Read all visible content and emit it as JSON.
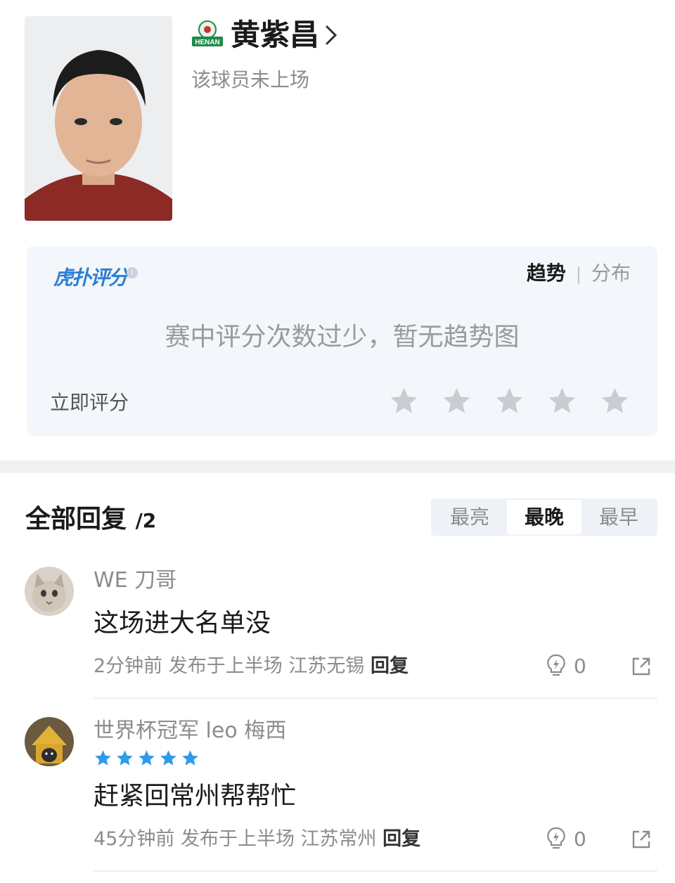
{
  "player": {
    "name": "黄紫昌",
    "status": "该球员未上场",
    "team_badge_text": "HENAN"
  },
  "rating": {
    "logo_text": "虎扑评分",
    "logo_mark": "®",
    "info_icon": "i",
    "tabs": {
      "active": "趋势",
      "separator": "|",
      "other": "分布"
    },
    "empty_message": "赛中评分次数过少，暂无趋势图",
    "rate_now_label": "立即评分",
    "star_count": 5
  },
  "replies": {
    "title": "全部回复",
    "count": "/2",
    "sort_tabs": [
      "最亮",
      "最晚",
      "最早"
    ],
    "active_sort": "最晚"
  },
  "comments": [
    {
      "username": "WE 刀哥",
      "text": "这场进大名单没",
      "time": "2分钟前",
      "published": "发布于上半场",
      "location": "江苏无锡",
      "reply_label": "回复",
      "likes": "0",
      "stars": 0
    },
    {
      "username": "世界杯冠军 leo 梅西",
      "text": "赶紧回常州帮帮忙",
      "time": "45分钟前",
      "published": "发布于上半场",
      "location": "江苏常州",
      "reply_label": "回复",
      "likes": "0",
      "stars": 5
    }
  ],
  "colors": {
    "accent_blue": "#2b7fd0",
    "star_blue": "#2f9be8",
    "star_grey": "#c9ccd1",
    "jersey_red": "#8c2a25",
    "badge_green": "#1f8a4c"
  },
  "icons": [
    "team-badge-icon",
    "chevron-right-icon",
    "info-icon",
    "star-icon",
    "lightbulb-icon",
    "share-icon"
  ]
}
